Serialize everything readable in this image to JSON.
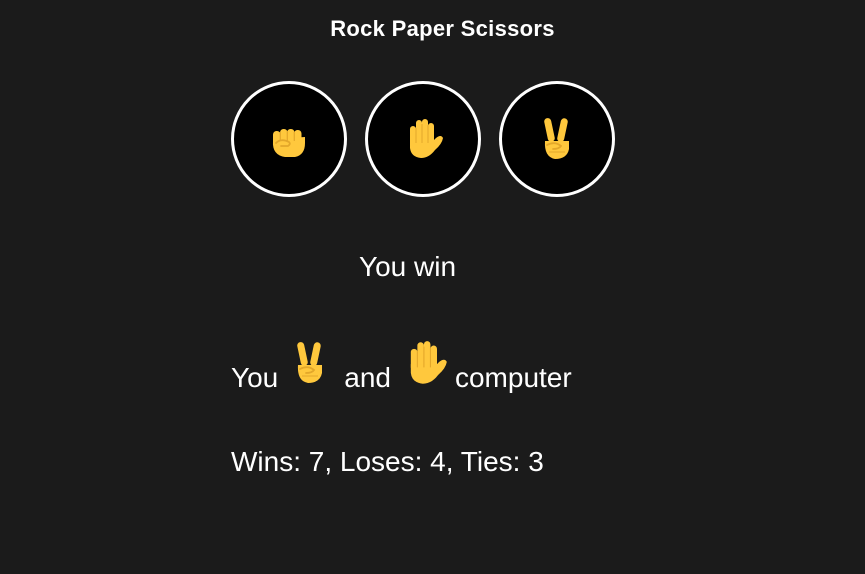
{
  "title": "Rock Paper Scissors",
  "choices": [
    {
      "name": "rock",
      "icon": "fist-icon"
    },
    {
      "name": "paper",
      "icon": "raised-hand-icon"
    },
    {
      "name": "scissors",
      "icon": "victory-hand-icon"
    }
  ],
  "result": "You win",
  "round": {
    "you_label": "You",
    "you_choice": "scissors",
    "and_label": "and",
    "computer_choice": "paper",
    "computer_label": "computer"
  },
  "score": {
    "text": "Wins: 7, Loses: 4, Ties: 3",
    "wins": 7,
    "loses": 4,
    "ties": 3
  },
  "colors": {
    "background": "#1b1b1b",
    "circle_fill": "#000000",
    "circle_border": "#ffffff",
    "hand": "#ffc83d",
    "hand_shadow": "#e3a72a"
  }
}
